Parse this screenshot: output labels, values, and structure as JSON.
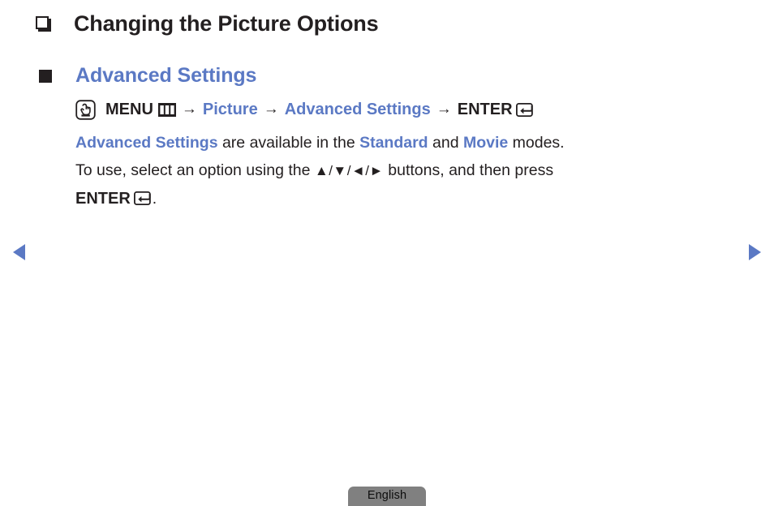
{
  "page": {
    "title": "Changing the Picture Options",
    "language_tab": "English",
    "accent_blue": "#5b79c4",
    "text_color": "#231f20",
    "tab_gray": "#808080"
  },
  "section": {
    "heading": "Advanced Settings",
    "bullet_icon": "filled-square-bullet-icon"
  },
  "menu_path": {
    "press_icon": "remote-button-press-icon",
    "menu_label": "MENU",
    "menu_icon": "menu-grid-icon",
    "arrow_1": "→",
    "step_picture": "Picture",
    "arrow_2": "→",
    "step_advanced": "Advanced Settings",
    "arrow_3": "→",
    "enter_label": "ENTER",
    "enter_icon": "enter-return-icon"
  },
  "paragraphs": {
    "line1": {
      "blue_1": "Advanced Settings",
      "text_1": " are available in the ",
      "blue_2": "Standard",
      "text_2": " and ",
      "blue_3": "Movie",
      "text_3": " modes."
    },
    "line2": {
      "text_1": "To use, select an option using the ",
      "dirkeys": "▲/▼/◄/►",
      "text_2": " buttons, and then press"
    },
    "line3": {
      "enter_label": "ENTER",
      "enter_icon": "enter-return-icon",
      "period": "."
    }
  },
  "navigation": {
    "prev_icon": "triangle-left-icon",
    "next_icon": "triangle-right-icon"
  }
}
